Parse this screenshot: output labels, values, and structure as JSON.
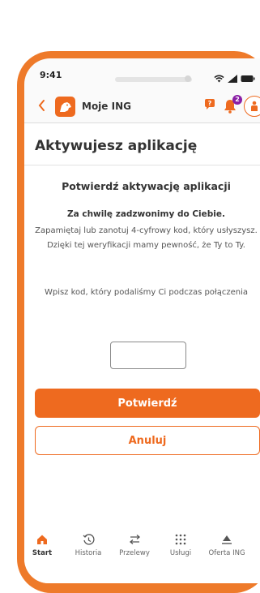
{
  "status": {
    "time": "9:41"
  },
  "header": {
    "app_title": "Moje ING",
    "notification_count": "2"
  },
  "page": {
    "title": "Aktywujesz aplikację"
  },
  "content": {
    "section_title": "Potwierdź aktywację aplikacji",
    "call_notice": "Za chwilę zadzwonimy do Ciebie.",
    "instructions": "Zapamiętaj lub zanotuj 4-cyfrowy kod, który usłyszysz. Dzięki tej weryfikacji mamy pewność, że Ty to Ty.",
    "code_prompt": "Wpisz kod, który podaliśmy Ci podczas połączenia",
    "code_value": "",
    "confirm_label": "Potwierdź",
    "cancel_label": "Anuluj"
  },
  "nav": {
    "items": [
      {
        "label": "Start",
        "icon": "home-icon",
        "active": true
      },
      {
        "label": "Historia",
        "icon": "history-icon",
        "active": false
      },
      {
        "label": "Przelewy",
        "icon": "transfer-icon",
        "active": false
      },
      {
        "label": "Usługi",
        "icon": "grid-icon",
        "active": false
      },
      {
        "label": "Oferta ING",
        "icon": "offer-icon",
        "active": false
      }
    ]
  },
  "colors": {
    "accent": "#ee6a1f",
    "badge": "#8a1fa5",
    "frame": "#ee7a2a"
  }
}
